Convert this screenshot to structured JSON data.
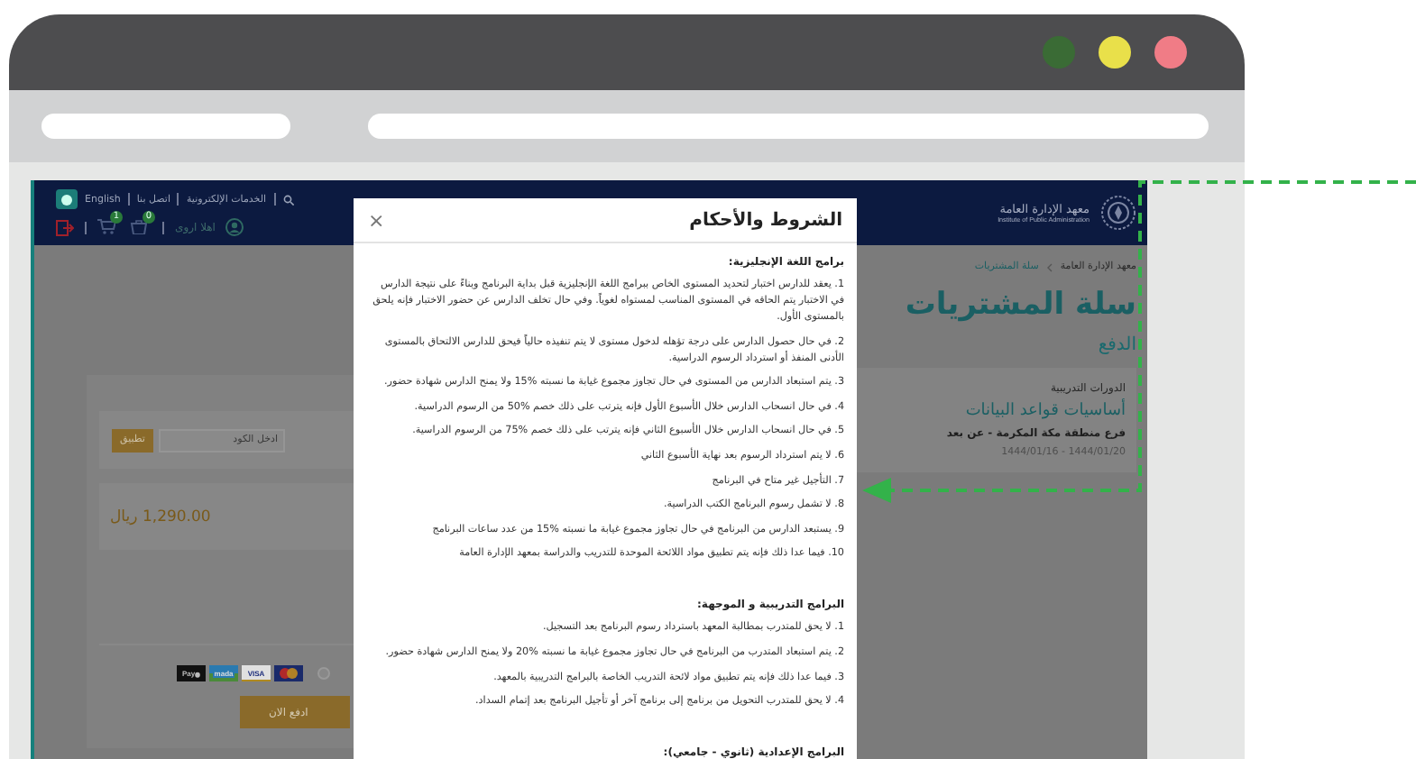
{
  "browser": {
    "window_controls": [
      {
        "color": "#3a6b35"
      },
      {
        "color": "#e9e04a"
      },
      {
        "color": "#f07c86"
      }
    ]
  },
  "site": {
    "header": {
      "language": "English",
      "links": [
        "الخدمات الإلكترونية",
        "اتصل بنا"
      ],
      "greeting": "اهلا اروى",
      "cart_count": "1",
      "orders_count": "0",
      "logo_title": "معهد الإدارة العامة",
      "logo_subtitle": "Institute of Public Administration"
    },
    "breadcrumb": [
      "معهد الإدارة العامة",
      "سلة المشتريات"
    ],
    "page_title": "سلة المشتريات",
    "section_title": "الدفع",
    "coupon": {
      "placeholder": "ادخل الكود",
      "button": "تطبيق"
    },
    "price": "1,290.00 ريال",
    "payment": {
      "selected": false,
      "methods": [
        {
          "kind": "mastercard"
        },
        {
          "kind": "visa",
          "label": "VISA"
        },
        {
          "kind": "mada",
          "label": "mada"
        },
        {
          "kind": "apple_pay",
          "label": "Pay"
        }
      ]
    },
    "pay_button": "ادفع الان",
    "course": {
      "category": "الدورات التدريبية",
      "name": "أساسيات قواعد البيانات",
      "branch": "فرع منطقة مكة المكرمة - عن بعد",
      "dates": "1444/01/20 - 1444/01/16"
    }
  },
  "modal": {
    "title": "الشروط والأحكام",
    "close": "×",
    "sections": [
      {
        "heading": "برامج اللغة الإنجليزية:",
        "items": [
          "1. يعقد للدارس اختبار لتحديد المستوى الخاص ببرامج اللغة الإنجليزية قبل بداية البرنامج وبناءً على نتيجة الدارس في الاختبار يتم الحاقه في المستوى المناسب لمستواه لغوياً. وفي حال تخلف الدارس عن حضور الاختبار فإنه يلحق بالمستوى الأول.",
          "2. في حال حصول الدارس على درجة تؤهله لدخول مستوى لا يتم تنفيذه حالياً فيحق للدارس الالتحاق بالمستوى الأدنى المنفذ أو استرداد الرسوم الدراسية.",
          "3. يتم استبعاد الدارس من المستوى في حال تجاوز مجموع غيابة ما نسبته %15 ولا يمنح الدارس شهادة حضور.",
          "4. في حال انسحاب الدارس خلال الأسبوع الأول فإنه يترتب على ذلك خصم %50 من الرسوم الدراسية.",
          "5. في حال انسحاب الدارس خلال الأسبوع الثاني فإنه يترتب على ذلك خصم %75 من الرسوم الدراسية.",
          "6. لا يتم استرداد الرسوم بعد نهاية الأسبوع الثاني",
          "7. التأجيل غير متاح في البرنامج",
          "8. لا تشمل رسوم البرنامج الكتب الدراسية.",
          "9. يستبعد الدارس من البرنامج في حال تجاوز مجموع غيابة ما نسبته %15 من عدد ساعات البرنامج",
          "10. فيما عدا ذلك فإنه يتم تطبيق مواد اللائحة الموحدة للتدريب والدراسة بمعهد الإدارة العامة"
        ]
      },
      {
        "heading": "البرامج التدريبية و الموجهة:",
        "items": [
          "1. لا يحق للمتدرب بمطالبة المعهد باسترداد رسوم البرنامج بعد التسجيل.",
          "2. يتم استبعاد المتدرب من البرنامج في حال تجاوز مجموع غيابة ما نسبته %20 ولا يمنح الدارس شهادة حضور.",
          "3. فيما عدا ذلك فإنه يتم تطبيق مواد لائحة التدريب الخاصة بالبرامج التدريبية بالمعهد.",
          "4. لا يحق للمتدرب التحويل من برنامج إلى برنامج آخر أو تأجيل البرنامج بعد إتمام السداد."
        ]
      },
      {
        "heading": "البرامج الإعدادية (ثانوي - جامعي):"
      }
    ]
  }
}
